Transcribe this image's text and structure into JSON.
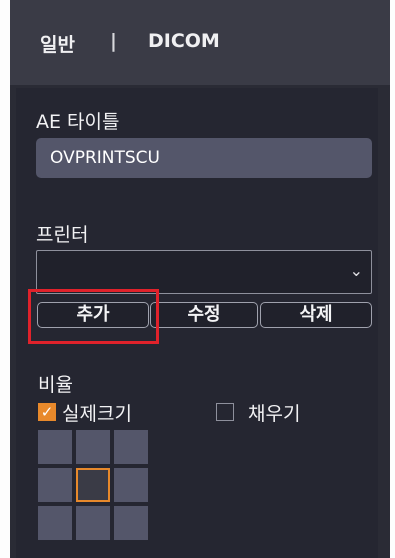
{
  "tabs": {
    "general_label": "일반",
    "separator": "|",
    "dicom_label": "DICOM"
  },
  "ae_title": {
    "label": "AE 타이틀",
    "value": "OVPRINTSCU"
  },
  "printer": {
    "label": "프린터",
    "selected": "",
    "caret": "⌄"
  },
  "buttons": {
    "add": "추가",
    "edit": "수정",
    "delete": "삭제"
  },
  "ratio": {
    "label": "비율",
    "actual_size": "실제크기",
    "actual_size_checked": true,
    "fill": "채우기",
    "fill_checked": false
  },
  "alignment_grid": {
    "rows": 3,
    "cols": 3,
    "selected_cell": "center"
  },
  "colors": {
    "accent": "#e8892b",
    "highlight": "#e0222b",
    "panel_bg": "#252631",
    "tab_bg": "#3a3b46",
    "field_bg": "#54566a"
  }
}
